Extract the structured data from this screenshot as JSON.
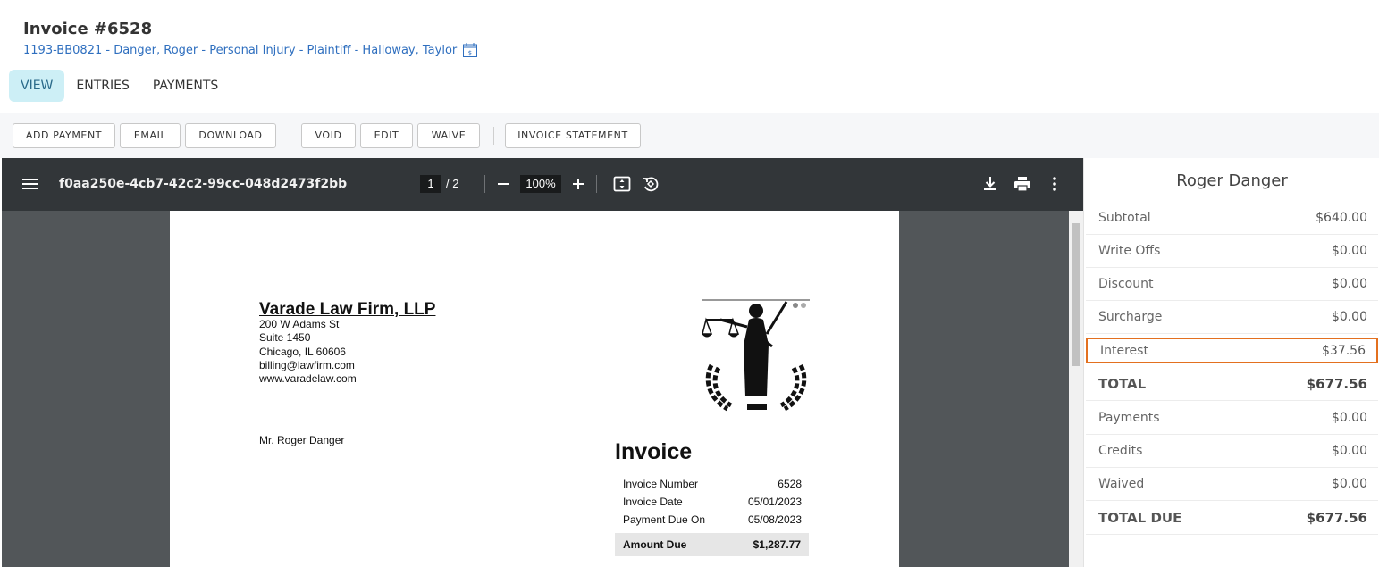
{
  "header": {
    "title": "Invoice #6528",
    "matter_link": "1193-BB0821 - Danger, Roger - Personal Injury - Plaintiff - Halloway, Taylor"
  },
  "tabs": [
    {
      "label": "VIEW",
      "active": true
    },
    {
      "label": "ENTRIES",
      "active": false
    },
    {
      "label": "PAYMENTS",
      "active": false
    }
  ],
  "toolbar": {
    "add_payment": "ADD PAYMENT",
    "email": "EMAIL",
    "download": "DOWNLOAD",
    "void": "VOID",
    "edit": "EDIT",
    "waive": "WAIVE",
    "invoice_statement": "INVOICE STATEMENT"
  },
  "viewer": {
    "filename": "f0aa250e-4cb7-42c2-99cc-048d2473f2bb",
    "current_page": "1",
    "total_pages": "/ 2",
    "zoom": "100%",
    "icons": [
      "menu-icon",
      "zoom-out-icon",
      "zoom-in-icon",
      "fit-page-icon",
      "rotate-icon",
      "download-icon",
      "print-icon",
      "more-vert-icon"
    ]
  },
  "document": {
    "firm_name": "Varade Law Firm, LLP",
    "address_lines": [
      "200 W Adams St",
      "Suite 1450",
      "Chicago, IL 60606",
      "billing@lawfirm.com",
      "www.varadelaw.com"
    ],
    "recipient": "Mr. Roger Danger",
    "heading": "Invoice",
    "details": [
      {
        "label": "Invoice Number",
        "value": "6528"
      },
      {
        "label": "Invoice Date",
        "value": "05/01/2023"
      },
      {
        "label": "Payment Due On",
        "value": "05/08/2023"
      }
    ],
    "amount_due_label": "Amount Due",
    "amount_due_value": "$1,287.77"
  },
  "summary": {
    "client": "Roger Danger",
    "rows": [
      {
        "label": "Subtotal",
        "value": "$640.00"
      },
      {
        "label": "Write Offs",
        "value": "$0.00"
      },
      {
        "label": "Discount",
        "value": "$0.00"
      },
      {
        "label": "Surcharge",
        "value": "$0.00"
      },
      {
        "label": "Interest",
        "value": "$37.56"
      },
      {
        "label": "TOTAL",
        "value": "$677.56"
      },
      {
        "label": "Payments",
        "value": "$0.00"
      },
      {
        "label": "Credits",
        "value": "$0.00"
      },
      {
        "label": "Waived",
        "value": "$0.00"
      },
      {
        "label": "TOTAL DUE",
        "value": "$677.56"
      }
    ]
  },
  "colors": {
    "link": "#2f6fbf",
    "active_tab_bg": "#cdeff6",
    "highlight_border": "#e3701f",
    "viewer_toolbar": "#323639",
    "viewer_bg": "#525659"
  }
}
